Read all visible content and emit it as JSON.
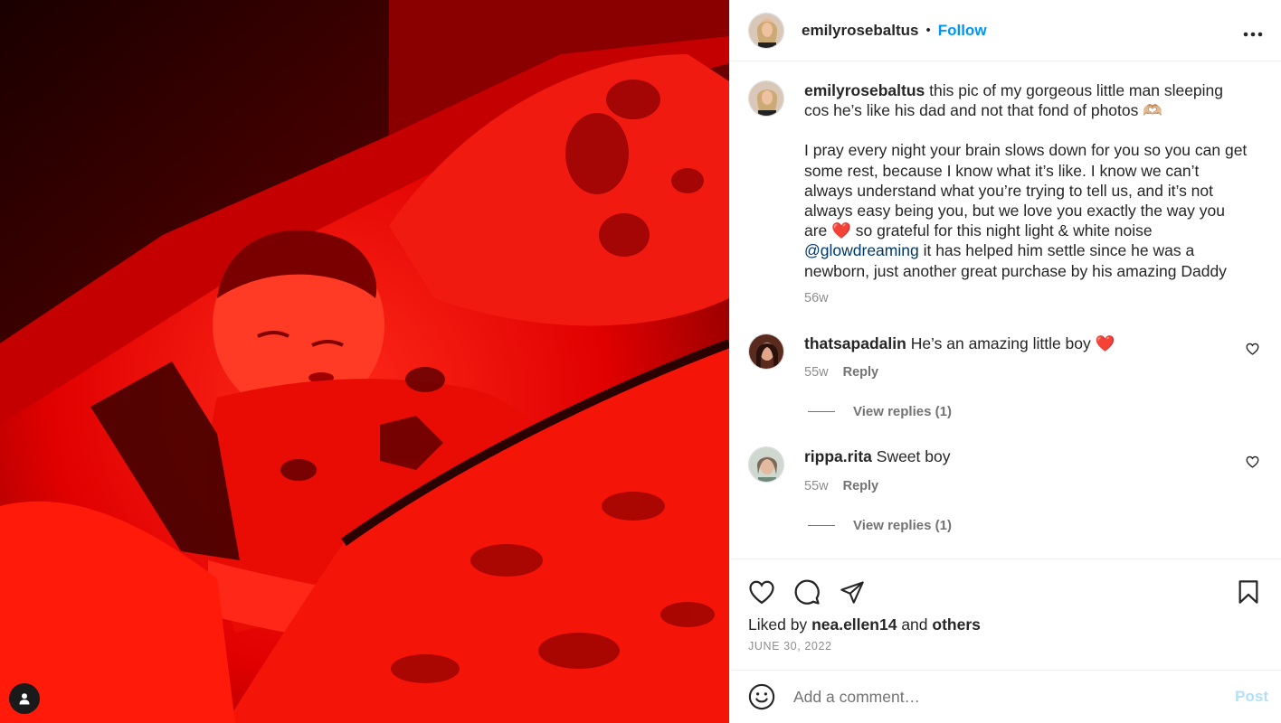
{
  "post": {
    "author": "emilyrosebaltus",
    "follow_label": "Follow",
    "separator": "•",
    "more_label": "•••"
  },
  "caption": {
    "username": "emilyrosebaltus",
    "line1": "this pic of my gorgeous little man sleeping cos he’s like his dad and not that fond of photos 🫶🏼",
    "line2_pre": "I pray every night your brain slows down for you so you can get some rest, because I know what it’s like. I know we can’t always understand what you’re trying to tell us, and it’s not always easy being you, but we love you exactly the way you are ❤️ so grateful for this night light & white noise",
    "mention": "@glowdreaming",
    "line2_post": " it has helped him settle since he was a newborn, just another great purchase by his amazing Daddy",
    "age": "56w"
  },
  "comments": [
    {
      "username": "thatsapadalin",
      "text": "He’s an amazing little boy ❤️",
      "age": "55w",
      "reply_label": "Reply",
      "view_replies": "View replies (1)"
    },
    {
      "username": "rippa.rita",
      "text": "Sweet boy",
      "age": "55w",
      "reply_label": "Reply",
      "view_replies": "View replies (1)"
    }
  ],
  "likes": {
    "prefix": "Liked by",
    "user": "nea.ellen14",
    "and": "and",
    "others": "others"
  },
  "date": "JUNE 30, 2022",
  "add_comment": {
    "placeholder": "Add a comment…",
    "post_label": "Post"
  },
  "colors": {
    "accent": "#0095f6",
    "mention": "#00376b",
    "photo_red": "#e00000"
  }
}
